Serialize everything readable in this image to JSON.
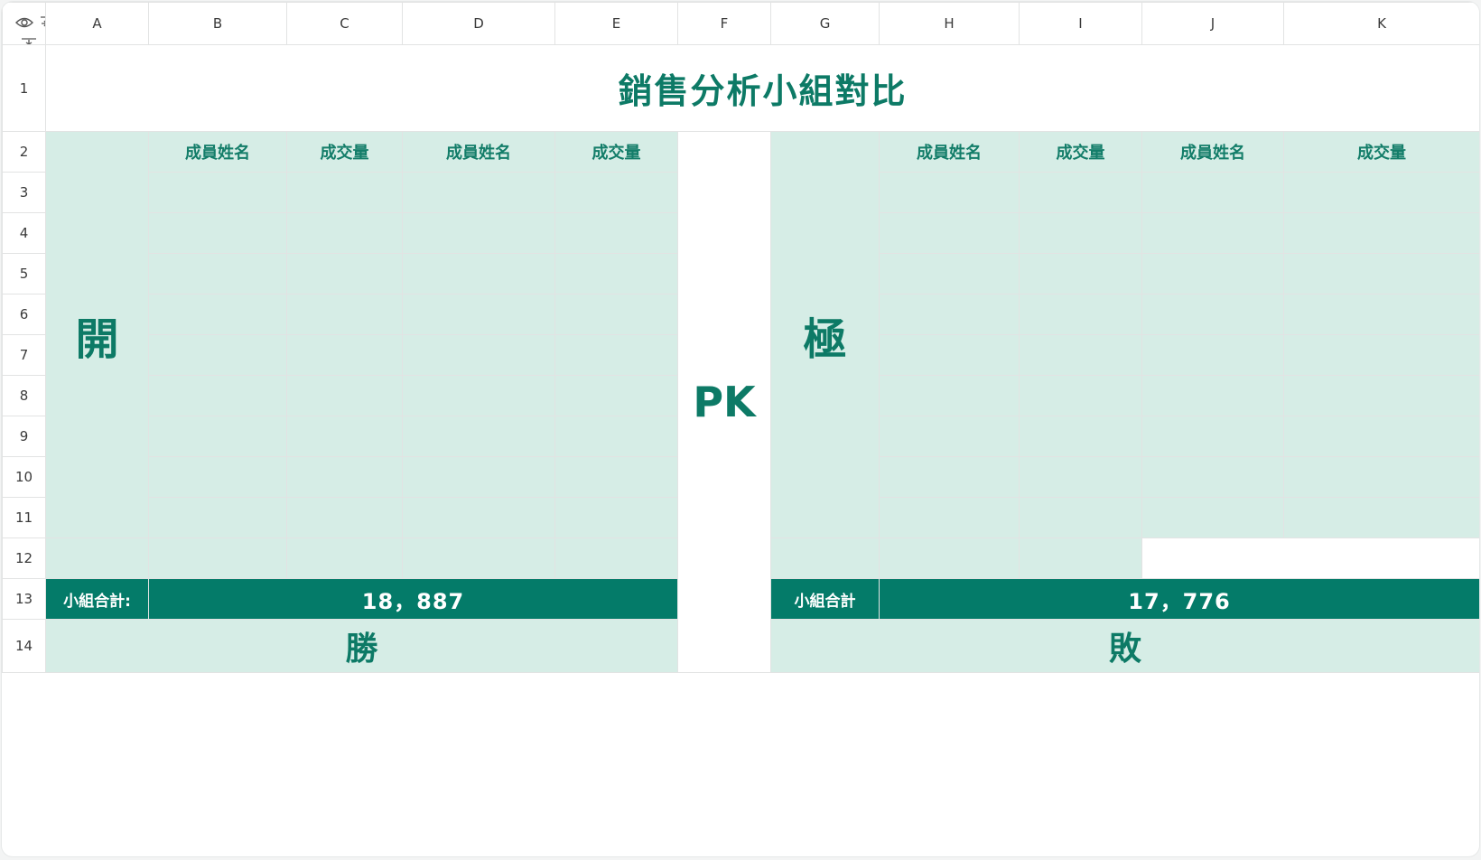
{
  "columns": [
    "A",
    "B",
    "C",
    "D",
    "E",
    "F",
    "G",
    "H",
    "I",
    "J",
    "K"
  ],
  "rows": [
    "1",
    "2",
    "3",
    "4",
    "5",
    "6",
    "7",
    "8",
    "9",
    "10",
    "11",
    "12",
    "13",
    "14"
  ],
  "toolbar": {
    "view_icon": "eye-icon",
    "freeze_columns_icon": "freeze-columns-icon",
    "freeze_rows_icon": "freeze-rows-icon"
  },
  "sheet": {
    "title": "銷售分析小組對比",
    "versus": "PK",
    "team_left": {
      "name": "開",
      "headers": [
        "成員姓名",
        "成交量",
        "成員姓名",
        "成交量"
      ],
      "total_label": "小組合計:",
      "total_value": "18，887",
      "result": "勝"
    },
    "team_right": {
      "name": "極",
      "headers": [
        "成員姓名",
        "成交量",
        "成員姓名",
        "成交量"
      ],
      "total_label": "小組合計",
      "total_value": "17，776",
      "result": "敗"
    }
  },
  "colors": {
    "accent": "#047b69",
    "text_green": "#0d7a66",
    "cell_green": "#d6ede6"
  }
}
